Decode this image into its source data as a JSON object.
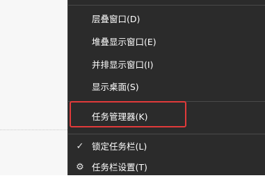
{
  "menu": {
    "items": [
      {
        "label": "层叠窗口(D)",
        "icon": ""
      },
      {
        "label": "堆叠显示窗口(E)",
        "icon": ""
      },
      {
        "label": "并排显示窗口(I)",
        "icon": ""
      },
      {
        "label": "显示桌面(S)",
        "icon": ""
      },
      {
        "label": "任务管理器(K)",
        "icon": ""
      },
      {
        "label": "锁定任务栏(L)",
        "icon": "checkmark-icon"
      },
      {
        "label": "任务栏设置(T)",
        "icon": "gear-icon"
      }
    ],
    "glyphs": {
      "checkmark": "✓",
      "gear": "⚙"
    }
  },
  "colors": {
    "menu_background": "#2b2b2b",
    "highlight_border": "#e23a3a",
    "text": "#ffffff"
  }
}
